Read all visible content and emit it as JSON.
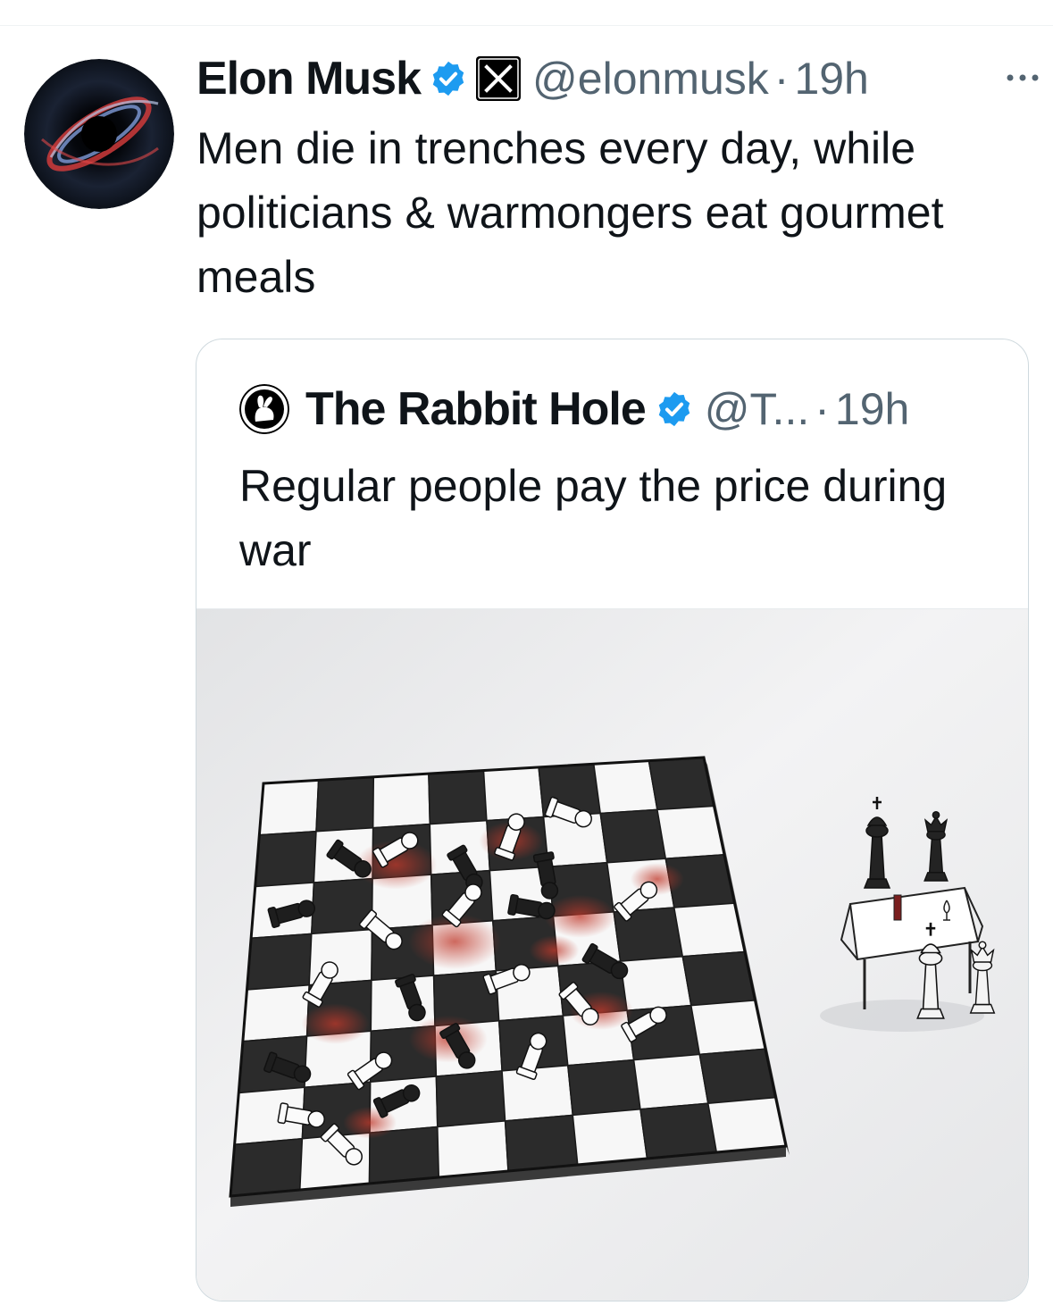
{
  "tweet": {
    "author": "Elon Musk",
    "handle": "@elonmusk",
    "separator": "·",
    "time": "19h",
    "text": "Men die in trenches every day, while politicians & warmongers eat gourmet meals",
    "icons": {
      "avatar": "black-hole-avatar",
      "verified": "verified-badge-icon",
      "affiliate": "x-logo-icon",
      "more": "more-options-icon"
    }
  },
  "quote": {
    "author": "The Rabbit Hole",
    "handle": "@T...",
    "separator": "·",
    "time": "19h",
    "text": "Regular people pay the price during war",
    "media": "chessboard-illustration",
    "icons": {
      "avatar": "rabbit-avatar",
      "verified": "verified-badge-icon"
    }
  },
  "colors": {
    "verified": "#1d9bf0",
    "secondary_text": "#536471",
    "blood": "#c0392b"
  }
}
